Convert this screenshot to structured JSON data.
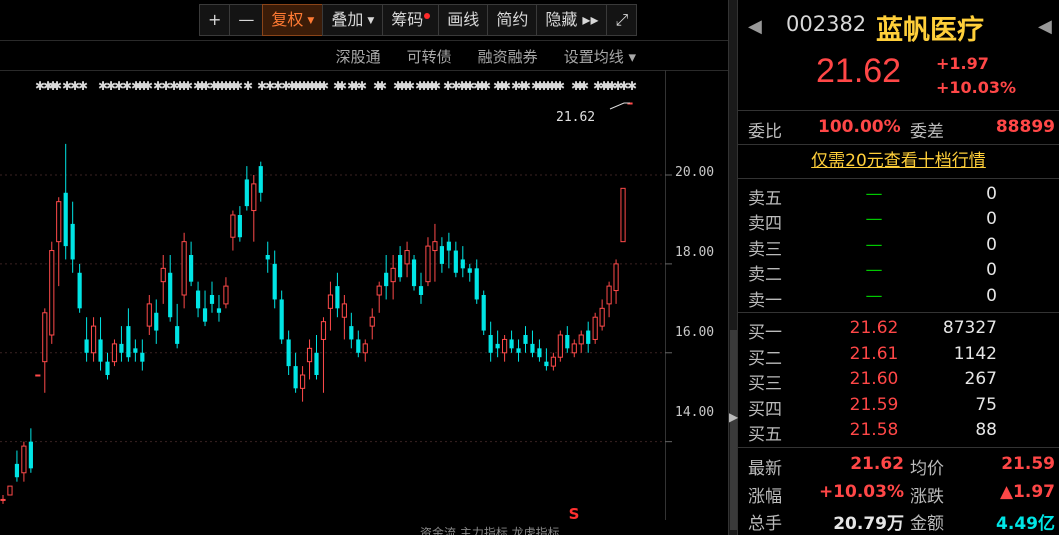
{
  "toolbar": {
    "buttons": [
      {
        "label": "+",
        "active": false,
        "caret": false,
        "dot": false
      },
      {
        "label": "—",
        "active": false,
        "caret": false,
        "dot": false
      },
      {
        "label": "复权",
        "active": true,
        "caret": true,
        "dot": false
      },
      {
        "label": "叠加",
        "active": false,
        "caret": true,
        "dot": false
      },
      {
        "label": "筹码",
        "active": false,
        "caret": false,
        "dot": true
      },
      {
        "label": "画线",
        "active": false,
        "caret": false,
        "dot": false
      },
      {
        "label": "简约",
        "active": false,
        "caret": false,
        "dot": false
      },
      {
        "label": "隐藏 ▸▸",
        "active": false,
        "caret": false,
        "dot": false
      },
      {
        "label": "⤢",
        "active": false,
        "caret": false,
        "dot": false
      }
    ]
  },
  "subtoolbar": {
    "items": [
      "深股通",
      "可转债",
      "融资融券",
      "设置均线 ▾"
    ]
  },
  "chart": {
    "last_price_tag": "21.62",
    "y_axis_labels": [
      "20.00",
      "18.00",
      "16.00",
      "14.00"
    ],
    "bottom_strip": "资金流  主力指标  龙虎指标",
    "s_marker": "S"
  },
  "chart_data": {
    "type": "candlestick",
    "ylim": [
      12.8,
      21.8
    ],
    "y_ticks": [
      20,
      18,
      16,
      14
    ],
    "colors": {
      "up": "#ff4a4a",
      "down": "#00e5e5",
      "flat": "#ff4a4a"
    },
    "candles": [
      [
        12.7,
        12.8,
        12.6,
        12.7
      ],
      [
        12.8,
        13.0,
        12.8,
        13.0
      ],
      [
        13.5,
        13.8,
        13.1,
        13.2
      ],
      [
        13.3,
        14.0,
        13.1,
        13.9
      ],
      [
        14.0,
        14.3,
        13.3,
        13.4
      ],
      [
        15.5,
        15.5,
        15.5,
        15.5
      ],
      [
        15.8,
        17.0,
        15.1,
        16.9
      ],
      [
        16.4,
        18.5,
        16.2,
        18.3
      ],
      [
        18.5,
        19.5,
        17.5,
        19.4
      ],
      [
        19.6,
        20.7,
        18.1,
        18.4
      ],
      [
        18.9,
        19.4,
        17.8,
        18.1
      ],
      [
        17.8,
        18.0,
        16.9,
        17.0
      ],
      [
        16.3,
        16.8,
        15.8,
        16.0
      ],
      [
        16.0,
        16.8,
        15.8,
        16.6
      ],
      [
        16.3,
        16.8,
        15.6,
        15.8
      ],
      [
        15.8,
        16.0,
        15.4,
        15.5
      ],
      [
        15.8,
        16.3,
        15.7,
        16.2
      ],
      [
        16.2,
        16.6,
        15.8,
        16.0
      ],
      [
        16.6,
        17.0,
        15.8,
        15.9
      ],
      [
        16.1,
        16.3,
        15.8,
        16.0
      ],
      [
        16.0,
        16.3,
        15.6,
        15.8
      ],
      [
        16.6,
        17.3,
        16.4,
        17.1
      ],
      [
        16.9,
        17.2,
        16.2,
        16.5
      ],
      [
        17.6,
        18.2,
        17.1,
        17.9
      ],
      [
        17.8,
        18.2,
        16.7,
        16.8
      ],
      [
        16.6,
        17.1,
        16.1,
        16.2
      ],
      [
        17.3,
        18.7,
        17.0,
        18.5
      ],
      [
        18.2,
        18.5,
        17.5,
        17.6
      ],
      [
        17.4,
        17.6,
        16.8,
        17.0
      ],
      [
        17.0,
        17.4,
        16.6,
        16.7
      ],
      [
        17.3,
        17.6,
        16.9,
        17.1
      ],
      [
        17.0,
        17.3,
        16.7,
        16.9
      ],
      [
        17.1,
        17.7,
        17.0,
        17.5
      ],
      [
        18.6,
        19.2,
        18.3,
        19.1
      ],
      [
        19.1,
        19.3,
        18.5,
        18.6
      ],
      [
        19.9,
        20.2,
        19.2,
        19.3
      ],
      [
        19.2,
        20.0,
        18.5,
        19.8
      ],
      [
        20.2,
        20.3,
        19.4,
        19.6
      ],
      [
        18.2,
        18.5,
        17.8,
        18.1
      ],
      [
        18.0,
        18.3,
        17.0,
        17.2
      ],
      [
        17.2,
        17.4,
        16.2,
        16.3
      ],
      [
        16.3,
        16.5,
        15.5,
        15.7
      ],
      [
        15.7,
        16.0,
        15.1,
        15.2
      ],
      [
        15.2,
        15.7,
        14.9,
        15.5
      ],
      [
        15.8,
        16.3,
        15.4,
        16.1
      ],
      [
        16.0,
        16.4,
        15.4,
        15.5
      ],
      [
        16.3,
        16.8,
        15.1,
        16.7
      ],
      [
        17.0,
        17.6,
        16.5,
        17.3
      ],
      [
        17.5,
        17.8,
        16.8,
        17.0
      ],
      [
        16.8,
        17.3,
        16.3,
        17.1
      ],
      [
        16.6,
        16.9,
        16.1,
        16.3
      ],
      [
        16.3,
        16.5,
        15.9,
        16.0
      ],
      [
        16.0,
        16.3,
        15.8,
        16.2
      ],
      [
        16.6,
        17.0,
        16.3,
        16.8
      ],
      [
        17.3,
        17.6,
        16.9,
        17.5
      ],
      [
        17.8,
        18.2,
        17.2,
        17.5
      ],
      [
        17.6,
        18.2,
        17.2,
        17.9
      ],
      [
        18.2,
        18.4,
        17.6,
        17.7
      ],
      [
        18.0,
        18.5,
        17.7,
        18.3
      ],
      [
        18.1,
        18.2,
        17.4,
        17.5
      ],
      [
        17.5,
        17.8,
        17.1,
        17.3
      ],
      [
        17.6,
        18.6,
        17.5,
        18.4
      ],
      [
        18.3,
        18.9,
        17.6,
        18.5
      ],
      [
        18.4,
        18.6,
        17.8,
        18.0
      ],
      [
        18.5,
        18.7,
        17.9,
        18.3
      ],
      [
        18.3,
        18.5,
        17.7,
        17.8
      ],
      [
        18.1,
        18.4,
        17.7,
        17.9
      ],
      [
        17.9,
        18.0,
        17.6,
        17.8
      ],
      [
        17.9,
        18.1,
        17.1,
        17.2
      ],
      [
        17.3,
        17.4,
        16.4,
        16.5
      ],
      [
        16.4,
        16.7,
        15.8,
        16.0
      ],
      [
        16.2,
        16.5,
        15.9,
        16.1
      ],
      [
        16.0,
        16.4,
        15.8,
        16.3
      ],
      [
        16.3,
        16.5,
        16.0,
        16.1
      ],
      [
        16.1,
        16.3,
        15.8,
        16.0
      ],
      [
        16.4,
        16.6,
        16.0,
        16.2
      ],
      [
        16.2,
        16.5,
        15.9,
        16.0
      ],
      [
        16.1,
        16.3,
        15.8,
        15.9
      ],
      [
        15.8,
        16.1,
        15.6,
        15.7
      ],
      [
        15.7,
        16.0,
        15.6,
        15.9
      ],
      [
        15.9,
        16.5,
        15.8,
        16.4
      ],
      [
        16.4,
        16.6,
        16.0,
        16.1
      ],
      [
        16.0,
        16.3,
        15.9,
        16.2
      ],
      [
        16.2,
        16.5,
        16.0,
        16.4
      ],
      [
        16.5,
        16.7,
        16.0,
        16.2
      ],
      [
        16.3,
        16.9,
        16.2,
        16.8
      ],
      [
        16.6,
        17.2,
        16.5,
        17.0
      ],
      [
        17.1,
        17.6,
        16.8,
        17.5
      ],
      [
        17.4,
        18.1,
        17.1,
        18.0
      ],
      [
        18.5,
        19.7,
        18.5,
        19.7
      ],
      [
        21.62,
        21.62,
        21.62,
        21.62
      ]
    ],
    "event_stars": [
      40,
      48,
      53,
      57,
      67,
      75,
      83,
      103,
      111,
      119,
      127,
      136,
      140,
      144,
      148,
      158,
      166,
      174,
      180,
      184,
      188,
      198,
      202,
      206,
      214,
      218,
      222,
      226,
      230,
      234,
      238,
      248,
      262,
      270,
      278,
      286,
      292,
      296,
      300,
      304,
      308,
      312,
      316,
      320,
      324,
      338,
      342,
      352,
      356,
      362,
      378,
      382,
      398,
      402,
      406,
      410,
      420,
      424,
      428,
      432,
      436,
      448,
      456,
      462,
      466,
      470,
      478,
      482,
      486,
      498,
      502,
      506,
      516,
      522,
      526,
      536,
      540,
      544,
      548,
      552,
      556,
      560,
      576,
      580,
      584,
      598,
      604,
      608,
      612,
      618,
      624,
      632
    ]
  },
  "quote": {
    "prev_arrow": "◀",
    "next_arrow": "◀",
    "code": "002382",
    "name": "蓝帆医疗",
    "price": "21.62",
    "change": "+1.97",
    "pct": "+10.03%",
    "weibi_label": "委比",
    "weibi_value": "100.00%",
    "weicha_label": "委差",
    "weicha_value": "88899",
    "promo": "仅需20元查看十档行情",
    "sell": [
      {
        "label": "卖五",
        "price": "—",
        "vol": "0"
      },
      {
        "label": "卖四",
        "price": "—",
        "vol": "0"
      },
      {
        "label": "卖三",
        "price": "—",
        "vol": "0"
      },
      {
        "label": "卖二",
        "price": "—",
        "vol": "0"
      },
      {
        "label": "卖一",
        "price": "—",
        "vol": "0"
      }
    ],
    "buy": [
      {
        "label": "买一",
        "price": "21.62",
        "vol": "87327"
      },
      {
        "label": "买二",
        "price": "21.61",
        "vol": "1142"
      },
      {
        "label": "买三",
        "price": "21.60",
        "vol": "267"
      },
      {
        "label": "买四",
        "price": "21.59",
        "vol": "75"
      },
      {
        "label": "买五",
        "price": "21.58",
        "vol": "88"
      }
    ],
    "stats": [
      {
        "l1": "最新",
        "v1": "21.62",
        "c1": "red",
        "l2": "均价",
        "v2": "21.59",
        "c2": "red"
      },
      {
        "l1": "涨幅",
        "v1": "+10.03%",
        "c1": "red",
        "l2": "涨跌",
        "v2": "▲1.97",
        "c2": "red"
      },
      {
        "l1": "总手",
        "v1": "20.79万",
        "c1": "white",
        "l2": "金额",
        "v2": "4.49亿",
        "c2": "cyan"
      }
    ]
  }
}
